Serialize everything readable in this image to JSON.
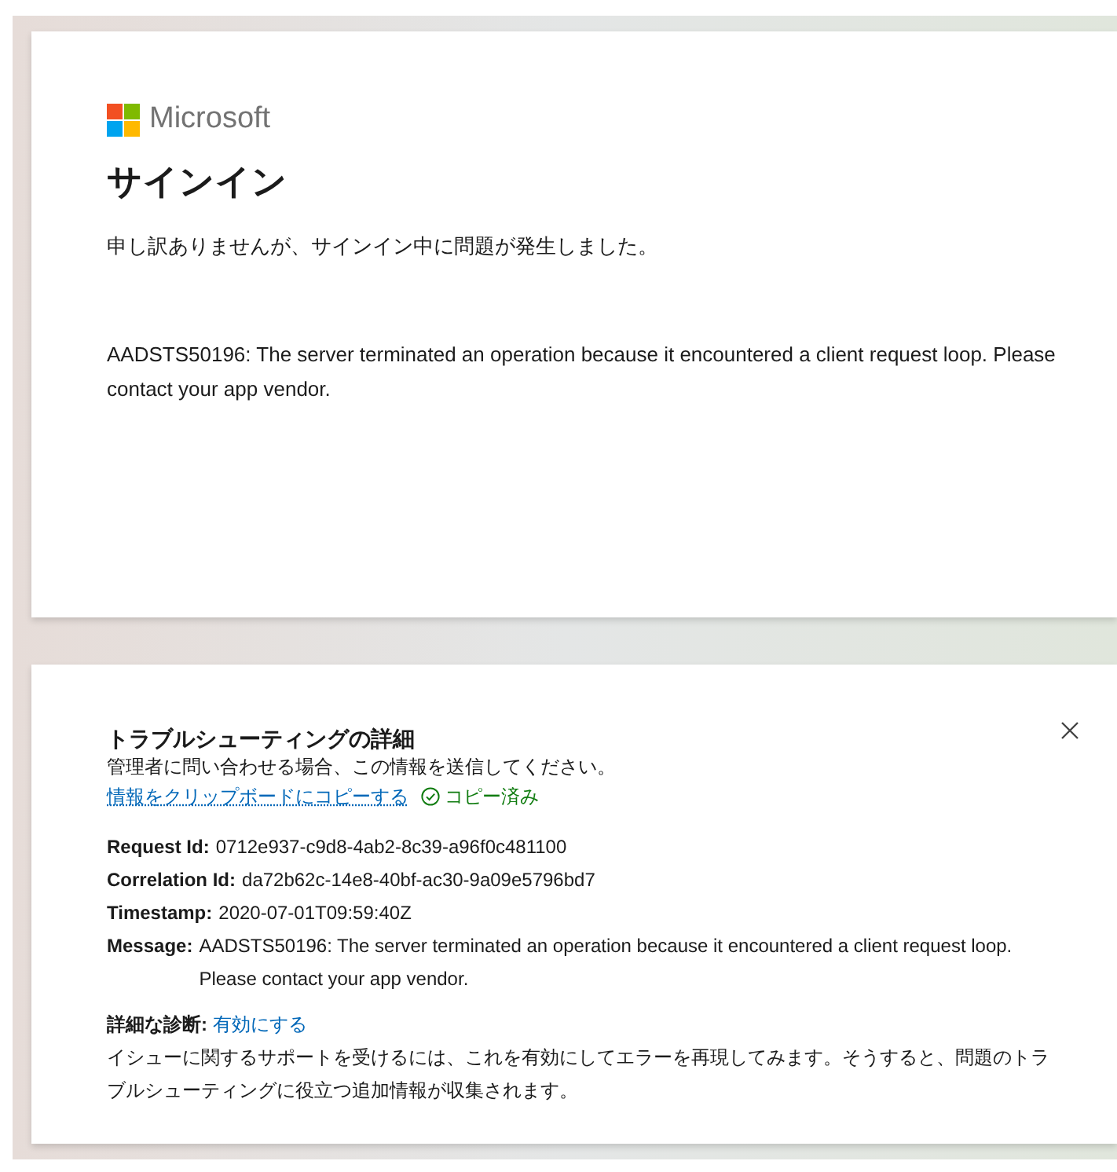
{
  "brand": "Microsoft",
  "signin": {
    "title": "サインイン",
    "subtitle": "申し訳ありませんが、サインイン中に問題が発生しました。",
    "error": "AADSTS50196: The server terminated an operation because it encountered a client request loop. Please contact your app vendor."
  },
  "troubleshooting": {
    "title": "トラブルシューティングの詳細",
    "hint": "管理者に問い合わせる場合、この情報を送信してください。",
    "copy_link": "情報をクリップボードにコピーする",
    "copied": true,
    "copied_label": "コピー済み",
    "details": [
      {
        "label": "Request Id:",
        "value": "0712e937-c9d8-4ab2-8c39-a96f0c481100"
      },
      {
        "label": "Correlation Id:",
        "value": "da72b62c-14e8-40bf-ac30-9a09e5796bd7"
      },
      {
        "label": "Timestamp:",
        "value": "2020-07-01T09:59:40Z"
      },
      {
        "label": "Message:",
        "value": "AADSTS50196: The server terminated an operation because it encountered a client request loop. Please contact your app vendor."
      }
    ],
    "diagnostics_label": "詳細な診断:",
    "diagnostics_link": "有効にする",
    "diagnostics_text": "イシューに関するサポートを受けるには、これを有効にしてエラーを再現してみます。そうすると、問題のトラブルシューティングに役立つ追加情報が収集されます。"
  }
}
